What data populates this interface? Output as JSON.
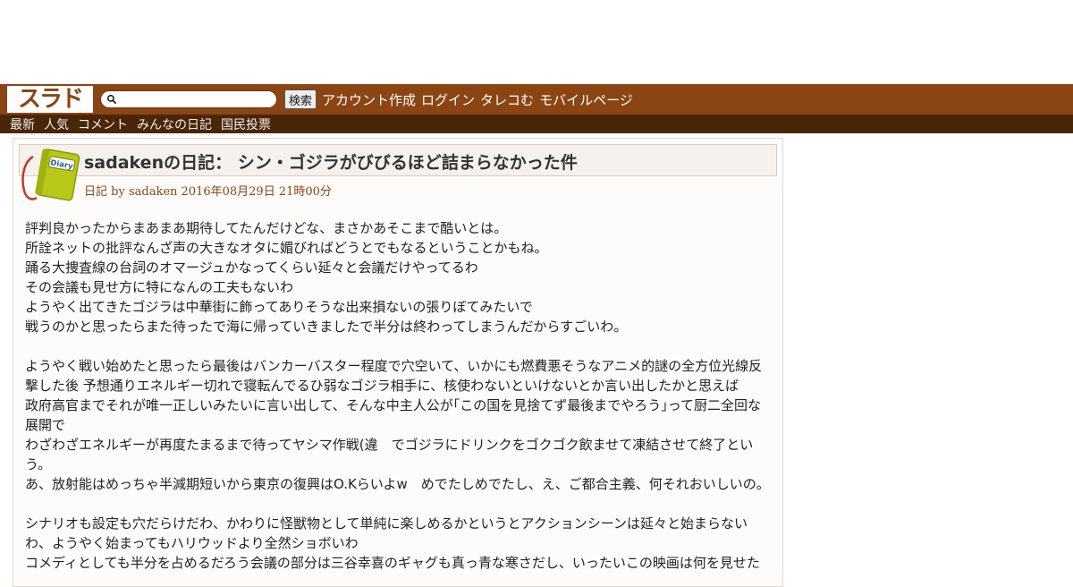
{
  "site": {
    "logo_text": "スラド",
    "search": {
      "placeholder": "",
      "value": "",
      "button_label": "検索"
    },
    "top_links": [
      "アカウント作成",
      "ログイン",
      "タレコむ",
      "モバイルページ"
    ],
    "nav": [
      "最新",
      "人気",
      "コメント",
      "みんなの日記",
      "国民投票"
    ],
    "colors": {
      "brand": "#8b4513",
      "nav_bg": "#4a2608",
      "icon_green": "#c8d820"
    }
  },
  "article": {
    "icon_label": "Diary",
    "title": "sadakenの日記： シン・ゴジラがびびるほど詰まらなかった件",
    "category": "日記",
    "byline": "by sadaken 2016年08月29日 21時00分",
    "paragraphs": [
      [
        "評判良かったからまあまあ期待してたんだけどな、まさかあそこまで酷いとは。",
        "所詮ネットの批評なんざ声の大きなオタに媚びればどうとでもなるということかもね。",
        "踊る大捜査線の台詞のオマージュかなってくらい延々と会議だけやってるわ",
        "その会議も見せ方に特になんの工夫もないわ",
        "ようやく出てきたゴジラは中華街に飾ってありそうな出来損ないの張りぼてみたいで",
        "戦うのかと思ったらまた待ったで海に帰っていきましたで半分は終わってしまうんだからすごいわ。"
      ],
      [
        "ようやく戦い始めたと思ったら最後はバンカーバスター程度で穴空いて、いかにも燃費悪そうなアニメ的謎の全方位光線反撃した後 予想通りエネルギー切れで寝転んでるひ弱なゴジラ相手に、核使わないといけないとか言い出したかと思えば",
        "政府高官までそれが唯一正しいみたいに言い出して、そんな中主人公が｢この国を見捨てず最後までやろう｣って厨二全回な展開で",
        "わざわざエネルギーが再度たまるまで待ってヤシマ作戦(違　でゴジラにドリンクをゴクゴク飲ませて凍結させて終了という。",
        "あ、放射能はめっちゃ半減期短いから東京の復興はO.Kらいよw　めでたしめでたし、え、ご都合主義、何それおいしいの。"
      ],
      [
        "シナリオも設定も穴だらけだわ、かわりに怪獣物として単純に楽しめるかというとアクションシーンは延々と始まらないわ、ようやく始まってもハリウッドより全然ショボいわ",
        "コメディとしても半分を占めるだろう会議の部分は三谷幸喜のギャグも真っ青な寒さだし、いったいこの映画は何を見せた"
      ]
    ]
  }
}
